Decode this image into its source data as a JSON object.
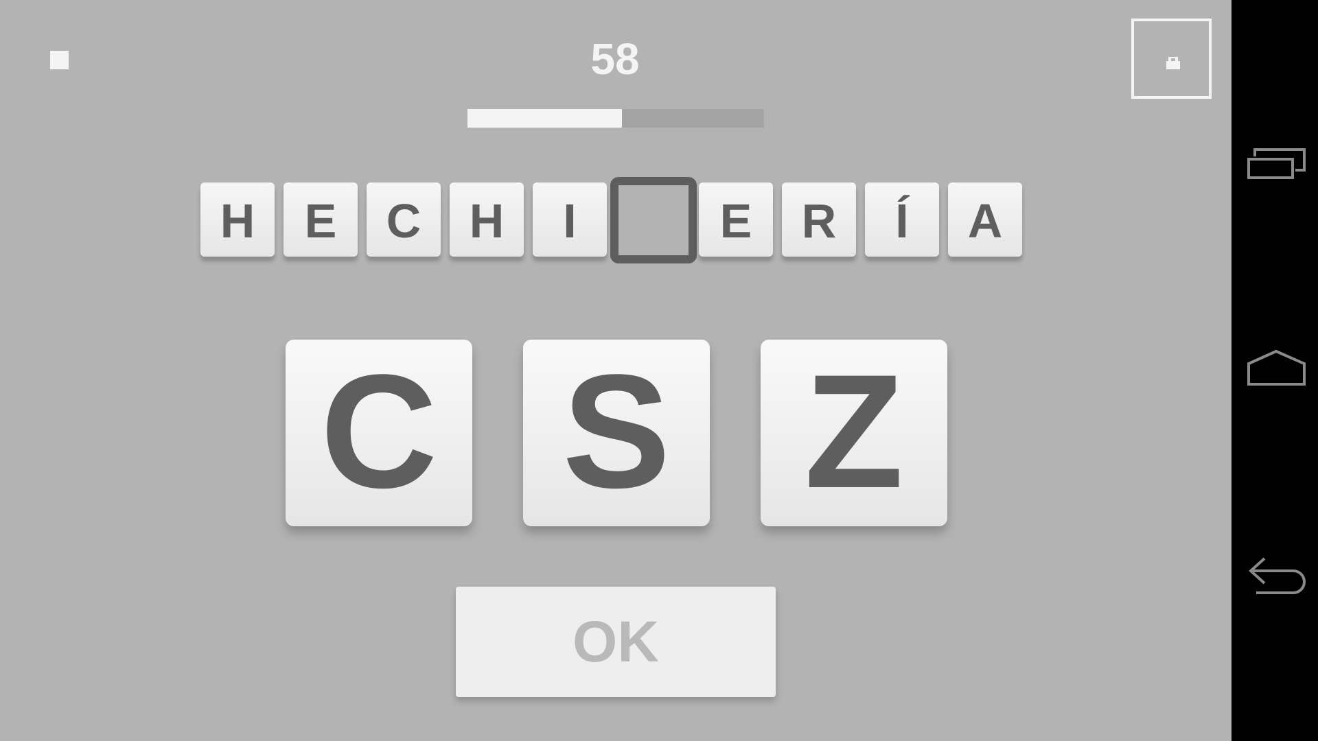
{
  "game": {
    "score": "58",
    "timer_progress": 0.52,
    "word_letters": [
      "H",
      "E",
      "C",
      "H",
      "I",
      "",
      "E",
      "R",
      "Í",
      "A"
    ],
    "missing_index": 5,
    "choices": [
      "C",
      "S",
      "Z"
    ],
    "ok_label": "OK"
  },
  "controls": {
    "stop_icon": "stop-icon",
    "hint_icon": "lock-icon"
  },
  "nav": {
    "icons": [
      "recent-apps-icon",
      "home-icon",
      "back-icon"
    ]
  },
  "colors": {
    "background": "#b3b3b3",
    "tile_text": "#5e5e5e",
    "light": "#f4f4f4",
    "ok_text": "#b9b9b9"
  }
}
